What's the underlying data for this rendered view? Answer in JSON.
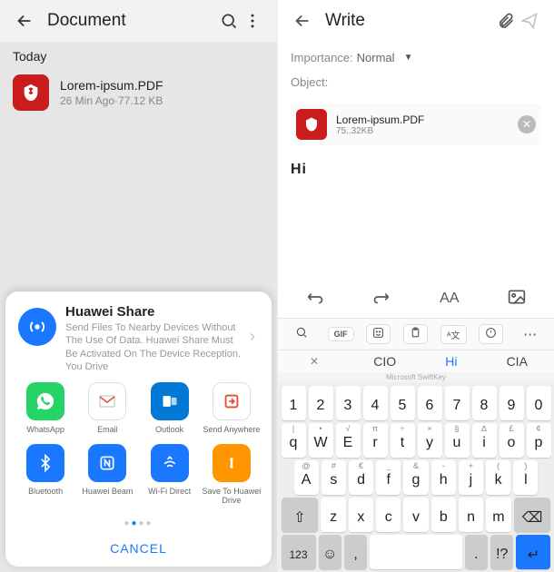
{
  "left": {
    "header_title": "Document",
    "section": "Today",
    "file": {
      "name": "Lorem-ipsum.PDF",
      "meta": "26 Min Ago·77.12 KB"
    },
    "huawei_share": {
      "title": "Huawei Share",
      "desc": "Send Files To Nearby Devices Without The Use Of Data. Huawei Share Must Be Activated On The Device Reception. You Drive"
    },
    "share_targets": [
      {
        "label": "WhatsApp"
      },
      {
        "label": "Email"
      },
      {
        "label": "Outlook"
      },
      {
        "label": "Send Anywhere"
      },
      {
        "label": "Bluetooth"
      },
      {
        "label": "Huawei Beam"
      },
      {
        "label": "Wi-Fi Direct"
      },
      {
        "label": "Save To Huawei Drive"
      }
    ],
    "cancel": "CANCEL"
  },
  "right": {
    "header_title": "Write",
    "importance_label": "Importance:",
    "importance_value": "Normal",
    "object_label": "Object:",
    "attachment": {
      "name": "Lorem-ipsum.PDF",
      "size": "75..32KB"
    },
    "body": "Hi"
  },
  "keyboard": {
    "suggestions": {
      "left": "CIO",
      "center": "Hi",
      "right": "CIA"
    },
    "row_num": [
      "1",
      "2",
      "3",
      "4",
      "5",
      "6",
      "7",
      "8",
      "9",
      "0"
    ],
    "row1_sup": [
      "|",
      "•",
      "√",
      "π",
      "÷",
      "×",
      "§",
      "∆",
      "£",
      "¢"
    ],
    "row1": [
      "q",
      "W",
      "E",
      "r",
      "t",
      "y",
      "u",
      "i",
      "o",
      "p"
    ],
    "row2_sup": [
      "@",
      "#",
      "€",
      "_",
      "&",
      "-",
      "+",
      "(",
      ")"
    ],
    "row2": [
      "A",
      "s",
      "d",
      "f",
      "g",
      "h",
      "j",
      "k",
      "l"
    ],
    "row3": [
      "z",
      "x",
      "c",
      "v",
      "b",
      "n",
      "m"
    ],
    "bottom": {
      "num": "123",
      "comma": ",",
      "period": "."
    },
    "brand": "Microsoft SwiftKey"
  }
}
